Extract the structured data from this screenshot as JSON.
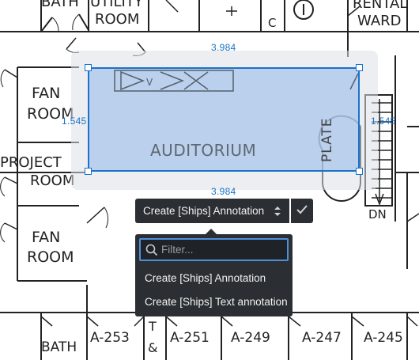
{
  "floor_plan": {
    "rooms": {
      "bath_top": "BATH",
      "utility_room_line1": "UTILITY",
      "utility_room_line2": "ROOM",
      "rental_ward_line1": "RENTAL",
      "rental_ward_line2": "WARD",
      "fan_room_1_line1": "FAN",
      "fan_room_1_line2": "ROOM",
      "projection_room_line1": "PROJECT",
      "projection_room_line2": "ROOM",
      "fan_room_2_line1": "FAN",
      "fan_room_2_line2": "ROOM",
      "auditorium": "AUDITORIUM",
      "plate": "PLATE",
      "dn": "DN",
      "bath_bottom": "BATH",
      "a253": "A-253",
      "t_and": "T",
      "amp": "&",
      "a251": "A-251",
      "a249": "A-249",
      "a247": "A-247",
      "a245": "A-245",
      "c_mark": "C",
      "v_mark": "V"
    }
  },
  "selection": {
    "width_top": "3.984",
    "width_bottom": "3.984",
    "height_left": "1.545",
    "height_right": "1.545"
  },
  "toolbar": {
    "annotation_type": "Create [Ships] Annotation"
  },
  "dropdown": {
    "filter_placeholder": "Filter...",
    "filter_value": "",
    "options": [
      "Create [Ships] Annotation",
      "Create [Ships] Text annotation"
    ]
  },
  "colors": {
    "selection_fill": "#b9cfee",
    "selection_border": "#1a73c9",
    "menu_bg": "#2b2f33",
    "accent": "#4f8fd8"
  },
  "icons": {
    "select_caret": "chevron-up-down-icon",
    "confirm": "checkmark-icon",
    "search": "search-icon"
  }
}
